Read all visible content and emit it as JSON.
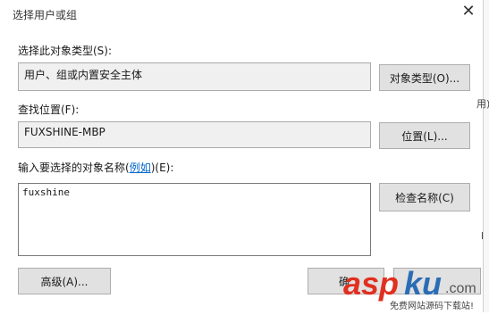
{
  "dialog": {
    "title": "选择用户或组",
    "close_glyph": "✕"
  },
  "object_type": {
    "label": "选择此对象类型(S):",
    "value": "用户、组或内置安全主体",
    "button": "对象类型(O)..."
  },
  "location": {
    "label": "查找位置(F):",
    "value": "FUXSHINE-MBP",
    "button": "位置(L)..."
  },
  "names": {
    "label_pre": "输入要选择的对象名称(",
    "label_link": "例如",
    "label_post": ")(E):",
    "value": "fuxshine",
    "check_button": "检查名称(C)"
  },
  "footer": {
    "advanced_button": "高级(A)...",
    "ok_button_partial": "确"
  },
  "background_window": {
    "fragment_1": "用)",
    "fragment_2": "l"
  },
  "watermark": {
    "brand": "aspku",
    "suffix": ".com",
    "tagline": "免费网站源码下载站!"
  }
}
